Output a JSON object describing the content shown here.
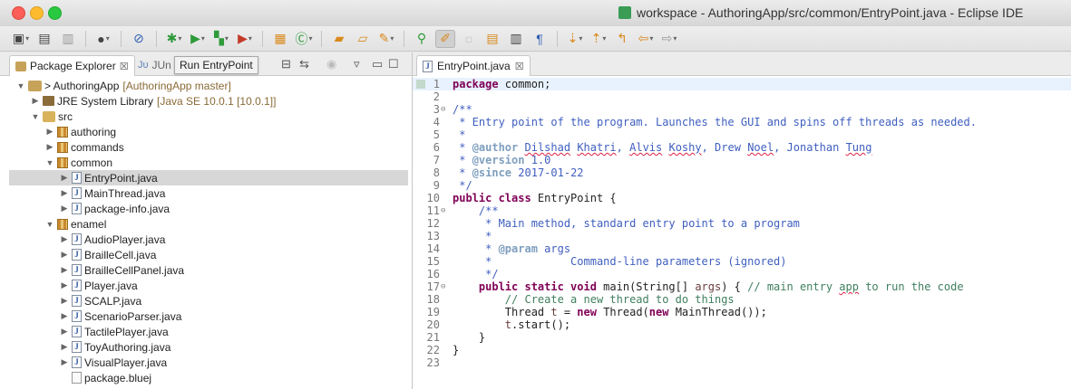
{
  "window": {
    "title": "workspace - AuthoringApp/src/common/EntryPoint.java - Eclipse IDE"
  },
  "toolbar": {
    "icons": [
      "new-icon",
      "save-icon",
      "save-all-icon",
      "avatar-icon",
      "skip-breakpoints-icon",
      "debug-icon",
      "run-icon",
      "coverage-icon",
      "external-tools-icon",
      "new-package-icon",
      "new-class-icon",
      "open-folder-icon",
      "open-type-icon",
      "search-icon",
      "toggle-mark-occurrences-icon",
      "highlight-icon",
      "show-whitespace-icon",
      "next-annotation-icon",
      "prev-annotation-icon",
      "last-edit-icon",
      "back-icon",
      "forward-icon"
    ]
  },
  "left_panel": {
    "tab_active": "Package Explorer",
    "tab_second": "JUn",
    "tooltip": "Run EntryPoint",
    "tree": [
      {
        "label": "> AuthoringApp",
        "extra": "[AuthoringApp master]",
        "level": 0,
        "icon": "project",
        "expanded": true
      },
      {
        "label": "JRE System Library",
        "extra": "[Java SE 10.0.1 [10.0.1]]",
        "level": 1,
        "icon": "library",
        "expanded": false
      },
      {
        "label": "src",
        "extra": "",
        "level": 1,
        "icon": "source-folder",
        "expanded": true
      },
      {
        "label": "authoring",
        "extra": "",
        "level": 2,
        "icon": "package",
        "expanded": false
      },
      {
        "label": "commands",
        "extra": "",
        "level": 2,
        "icon": "package",
        "expanded": false
      },
      {
        "label": "common",
        "extra": "",
        "level": 2,
        "icon": "package",
        "expanded": true
      },
      {
        "label": "EntryPoint.java",
        "extra": "",
        "level": 3,
        "icon": "java",
        "expanded": false,
        "selected": true
      },
      {
        "label": "MainThread.java",
        "extra": "",
        "level": 3,
        "icon": "java",
        "expanded": false
      },
      {
        "label": "package-info.java",
        "extra": "",
        "level": 3,
        "icon": "java",
        "expanded": false
      },
      {
        "label": "enamel",
        "extra": "",
        "level": 2,
        "icon": "package",
        "expanded": true
      },
      {
        "label": "AudioPlayer.java",
        "extra": "",
        "level": 3,
        "icon": "java",
        "expanded": false
      },
      {
        "label": "BrailleCell.java",
        "extra": "",
        "level": 3,
        "icon": "java",
        "expanded": false
      },
      {
        "label": "BrailleCellPanel.java",
        "extra": "",
        "level": 3,
        "icon": "java",
        "expanded": false
      },
      {
        "label": "Player.java",
        "extra": "",
        "level": 3,
        "icon": "java",
        "expanded": false
      },
      {
        "label": "SCALP.java",
        "extra": "",
        "level": 3,
        "icon": "java",
        "expanded": false
      },
      {
        "label": "ScenarioParser.java",
        "extra": "",
        "level": 3,
        "icon": "java",
        "expanded": false
      },
      {
        "label": "TactilePlayer.java",
        "extra": "",
        "level": 3,
        "icon": "java",
        "expanded": false
      },
      {
        "label": "ToyAuthoring.java",
        "extra": "",
        "level": 3,
        "icon": "java",
        "expanded": false
      },
      {
        "label": "VisualPlayer.java",
        "extra": "",
        "level": 3,
        "icon": "java",
        "expanded": false
      },
      {
        "label": "package.bluej",
        "extra": "",
        "level": 3,
        "icon": "file",
        "leaf": true
      }
    ]
  },
  "editor": {
    "tab": "EntryPoint.java",
    "lines": [
      {
        "n": "1",
        "fold": "",
        "html": "<span class=\"kw\">package</span> common;"
      },
      {
        "n": "2",
        "fold": "",
        "html": ""
      },
      {
        "n": "3",
        "fold": "⊖",
        "html": "<span class=\"doc\">/**</span>"
      },
      {
        "n": "4",
        "fold": "",
        "html": "<span class=\"doc\"> * Entry point of the program. Launches the GUI and spins off threads as needed.</span>"
      },
      {
        "n": "5",
        "fold": "",
        "html": "<span class=\"doc\"> *</span>"
      },
      {
        "n": "6",
        "fold": "",
        "html": "<span class=\"doc\"> * </span><span class=\"tag\">@author</span><span class=\"doc\"> <span class=\"sq\">Dilshad</span> <span class=\"sq\">Khatri</span>, <span class=\"sq\">Alvis</span> <span class=\"sq\">Koshy</span>, Drew <span class=\"sq\">Noel</span>, Jonathan <span class=\"sq\">Tung</span></span>"
      },
      {
        "n": "7",
        "fold": "",
        "html": "<span class=\"doc\"> * </span><span class=\"tag\">@version</span><span class=\"doc\"> 1.0</span>"
      },
      {
        "n": "8",
        "fold": "",
        "html": "<span class=\"doc\"> * </span><span class=\"tag\">@since</span><span class=\"doc\"> 2017-01-22</span>"
      },
      {
        "n": "9",
        "fold": "",
        "html": "<span class=\"doc\"> */</span>"
      },
      {
        "n": "10",
        "fold": "",
        "html": "<span class=\"kw\">public class</span> EntryPoint {"
      },
      {
        "n": "11",
        "fold": "⊖",
        "html": "    <span class=\"doc\">/**</span>"
      },
      {
        "n": "12",
        "fold": "",
        "html": "<span class=\"doc\">     * Main method, standard entry point to a program</span>"
      },
      {
        "n": "13",
        "fold": "",
        "html": "<span class=\"doc\">     *</span>"
      },
      {
        "n": "14",
        "fold": "",
        "html": "<span class=\"doc\">     * </span><span class=\"tag\">@param</span><span class=\"doc\"> args</span>"
      },
      {
        "n": "15",
        "fold": "",
        "html": "<span class=\"doc\">     *            Command-line parameters (ignored)</span>"
      },
      {
        "n": "16",
        "fold": "",
        "html": "<span class=\"doc\">     */</span>"
      },
      {
        "n": "17",
        "fold": "⊖",
        "html": "    <span class=\"kw\">public static void</span> main(String[] <span class=\"var\">args</span>) { <span class=\"cm\">// main entry <span class=\"sq\">app</span> to run the code</span>"
      },
      {
        "n": "18",
        "fold": "",
        "html": "        <span class=\"cm\">// Create a new thread to do things</span>"
      },
      {
        "n": "19",
        "fold": "",
        "html": "        Thread <span class=\"var\">t</span> = <span class=\"kw\">new</span> Thread(<span class=\"kw\">new</span> MainThread());"
      },
      {
        "n": "20",
        "fold": "",
        "html": "        <span class=\"var\">t</span>.start();"
      },
      {
        "n": "21",
        "fold": "",
        "html": "    }"
      },
      {
        "n": "22",
        "fold": "",
        "html": "}"
      },
      {
        "n": "23",
        "fold": "",
        "html": ""
      }
    ]
  }
}
